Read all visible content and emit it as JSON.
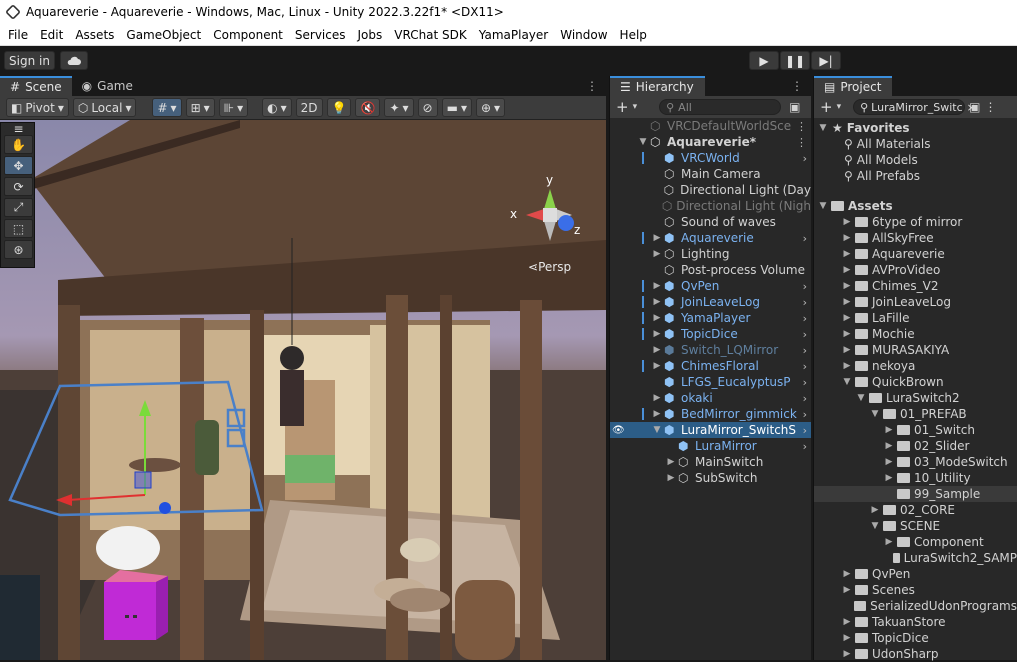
{
  "window": {
    "title": "Aquareverie - Aquareverie - Windows, Mac, Linux - Unity 2022.3.22f1* <DX11>"
  },
  "menu": [
    "File",
    "Edit",
    "Assets",
    "GameObject",
    "Component",
    "Services",
    "Jobs",
    "VRChat SDK",
    "YamaPlayer",
    "Window",
    "Help"
  ],
  "toolbar": {
    "signin": "Sign in"
  },
  "scene": {
    "tabs": [
      {
        "label": "Scene",
        "icon": "grid-icon"
      },
      {
        "label": "Game",
        "icon": "gamepad-icon"
      }
    ],
    "pivot": "Pivot",
    "local": "Local",
    "mode2d": "2D",
    "persp": "Persp",
    "axes": {
      "x": "x",
      "y": "y",
      "z": "z"
    }
  },
  "hierarchy": {
    "title": "Hierarchy",
    "search_placeholder": "All",
    "items": [
      {
        "label": "VRCDefaultWorldSce",
        "depth": 0,
        "state": "disabled",
        "icon": "unity-icon",
        "arrow": "",
        "chev": false,
        "menu": true
      },
      {
        "label": "Aquareverie*",
        "depth": 0,
        "state": "bold",
        "icon": "unity-icon",
        "arrow": "▼",
        "chev": false,
        "menu": true
      },
      {
        "label": "VRCWorld",
        "depth": 1,
        "state": "prefab",
        "icon": "prefab-cube-icon",
        "arrow": "",
        "chev": true,
        "bar": true
      },
      {
        "label": "Main Camera",
        "depth": 1,
        "state": "normal",
        "icon": "cube-icon",
        "arrow": ""
      },
      {
        "label": "Directional Light (Day",
        "depth": 1,
        "state": "normal",
        "icon": "cube-icon",
        "arrow": ""
      },
      {
        "label": "Directional Light (Nigh",
        "depth": 1,
        "state": "disabled",
        "icon": "cube-icon",
        "arrow": ""
      },
      {
        "label": "Sound of waves",
        "depth": 1,
        "state": "normal",
        "icon": "cube-icon",
        "arrow": ""
      },
      {
        "label": "Aquareverie",
        "depth": 1,
        "state": "prefab",
        "icon": "prefab-cube-icon",
        "arrow": "▶",
        "chev": true,
        "bar": true
      },
      {
        "label": "Lighting",
        "depth": 1,
        "state": "normal",
        "icon": "cube-icon",
        "arrow": "▶"
      },
      {
        "label": "Post-process Volume",
        "depth": 1,
        "state": "normal",
        "icon": "cube-icon",
        "arrow": ""
      },
      {
        "label": "QvPen",
        "depth": 1,
        "state": "prefab",
        "icon": "prefab-cube-icon",
        "arrow": "▶",
        "chev": true,
        "bar": true
      },
      {
        "label": "JoinLeaveLog",
        "depth": 1,
        "state": "prefab",
        "icon": "prefab-cube-icon",
        "arrow": "▶",
        "chev": true,
        "bar": true
      },
      {
        "label": "YamaPlayer",
        "depth": 1,
        "state": "prefab",
        "icon": "prefab-cube-icon",
        "arrow": "▶",
        "chev": true,
        "bar": true
      },
      {
        "label": "TopicDice",
        "depth": 1,
        "state": "prefab",
        "icon": "prefab-cube-icon",
        "arrow": "▶",
        "chev": true,
        "bar": true
      },
      {
        "label": "Switch_LQMirror",
        "depth": 1,
        "state": "prefab-disabled",
        "icon": "prefab-cube-icon",
        "arrow": "▶",
        "chev": true
      },
      {
        "label": "ChimesFloral",
        "depth": 1,
        "state": "prefab",
        "icon": "prefab-cube-icon",
        "arrow": "▶",
        "chev": true,
        "bar": true
      },
      {
        "label": "LFGS_EucalyptusP",
        "depth": 1,
        "state": "prefab",
        "icon": "prefab-cube-icon",
        "arrow": "",
        "chev": true
      },
      {
        "label": "okaki",
        "depth": 1,
        "state": "prefab",
        "icon": "prefab-cube-icon",
        "arrow": "▶",
        "chev": true
      },
      {
        "label": "BedMirror_gimmick",
        "depth": 1,
        "state": "prefab",
        "icon": "prefab-cube-icon",
        "arrow": "▶",
        "chev": true,
        "bar": true
      },
      {
        "label": "LuraMirror_SwitchS",
        "depth": 1,
        "state": "selected",
        "icon": "prefab-cube-icon",
        "arrow": "▼",
        "chev": true
      },
      {
        "label": "LuraMirror",
        "depth": 2,
        "state": "prefab",
        "icon": "prefab-cube-icon",
        "arrow": "",
        "chev": true
      },
      {
        "label": "MainSwitch",
        "depth": 2,
        "state": "normal",
        "icon": "cube-icon",
        "arrow": "▶"
      },
      {
        "label": "SubSwitch",
        "depth": 2,
        "state": "normal",
        "icon": "cube-icon",
        "arrow": "▶"
      }
    ]
  },
  "project": {
    "title": "Project",
    "search_value": "LuraMirror_Switc",
    "favorites_label": "Favorites",
    "favorites": [
      "All Materials",
      "All Models",
      "All Prefabs"
    ],
    "assets_label": "Assets",
    "items": [
      {
        "label": "6type of mirror",
        "depth": 1,
        "arrow": "▶"
      },
      {
        "label": "AllSkyFree",
        "depth": 1,
        "arrow": "▶"
      },
      {
        "label": "Aquareverie",
        "depth": 1,
        "arrow": "▶"
      },
      {
        "label": "AVProVideo",
        "depth": 1,
        "arrow": "▶"
      },
      {
        "label": "Chimes_V2",
        "depth": 1,
        "arrow": "▶"
      },
      {
        "label": "JoinLeaveLog",
        "depth": 1,
        "arrow": "▶"
      },
      {
        "label": "LaFille",
        "depth": 1,
        "arrow": "▶"
      },
      {
        "label": "Mochie",
        "depth": 1,
        "arrow": "▶"
      },
      {
        "label": "MURASAKIYA",
        "depth": 1,
        "arrow": "▶"
      },
      {
        "label": "nekoya",
        "depth": 1,
        "arrow": "▶"
      },
      {
        "label": "QuickBrown",
        "depth": 1,
        "arrow": "▼"
      },
      {
        "label": "LuraSwitch2",
        "depth": 2,
        "arrow": "▼"
      },
      {
        "label": "01_PREFAB",
        "depth": 3,
        "arrow": "▼"
      },
      {
        "label": "01_Switch",
        "depth": 4,
        "arrow": "▶"
      },
      {
        "label": "02_Slider",
        "depth": 4,
        "arrow": "▶"
      },
      {
        "label": "03_ModeSwitch",
        "depth": 4,
        "arrow": "▶"
      },
      {
        "label": "10_Utility",
        "depth": 4,
        "arrow": "▶"
      },
      {
        "label": "99_Sample",
        "depth": 4,
        "arrow": "",
        "hl": true
      },
      {
        "label": "02_CORE",
        "depth": 3,
        "arrow": "▶"
      },
      {
        "label": "SCENE",
        "depth": 3,
        "arrow": "▼"
      },
      {
        "label": "Component",
        "depth": 4,
        "arrow": "▶"
      },
      {
        "label": "LuraSwitch2_SAMP",
        "depth": 4,
        "arrow": ""
      },
      {
        "label": "QvPen",
        "depth": 1,
        "arrow": "▶"
      },
      {
        "label": "Scenes",
        "depth": 1,
        "arrow": "▶"
      },
      {
        "label": "SerializedUdonPrograms",
        "depth": 1,
        "arrow": ""
      },
      {
        "label": "TakuanStore",
        "depth": 1,
        "arrow": "▶"
      },
      {
        "label": "TopicDice",
        "depth": 1,
        "arrow": "▶"
      },
      {
        "label": "UdonSharp",
        "depth": 1,
        "arrow": "▶"
      }
    ]
  },
  "colors": {
    "accent": "#3a8edc",
    "selected_row": "#2c5d87",
    "prefab_text": "#7bb2f0",
    "panel_bg": "#282828"
  }
}
